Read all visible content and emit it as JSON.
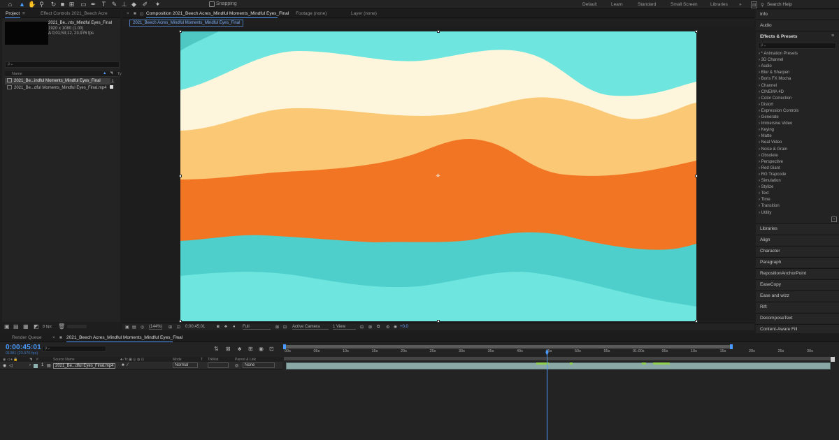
{
  "toolbar": {
    "snapping_label": "Snapping",
    "workspaces": [
      "Default",
      "Learn",
      "Standard",
      "Small Screen",
      "Libraries"
    ],
    "search_help": "Search Help"
  },
  "project_panel": {
    "tabs": [
      "Project",
      "Effect Controls 2021_Beech Acre"
    ],
    "comp_name": "2021_Be...nts_Mindful Eyes_Final",
    "comp_resolution": "1920 x 1080 (1.00)",
    "comp_duration": "Δ 0;01;53;12, 23.976 fps",
    "search_placeholder": "ρ⌄",
    "column_name": "Name",
    "column_type": "Ty",
    "items": [
      {
        "name": "2021_Be...indful Moments_Mindful Eyes_Final",
        "selected": true
      },
      {
        "name": "2021_Be...dful Moments_Mindful Eyes_Final.mp4",
        "selected": false
      }
    ],
    "bpc": "8 bpc"
  },
  "composition_panel": {
    "tabs": [
      {
        "label": "Composition 2021_Beech Acres_Mindful Moments_Mindful Eyes_Final",
        "active": true
      },
      {
        "label": "Footage (none)",
        "active": false
      },
      {
        "label": "Layer (none)",
        "active": false
      }
    ],
    "breadcrumb": "2021_Beech Acres_Mindful Moments_Mindful Eyes_Final",
    "viewer_bar": {
      "zoom": "(144%)",
      "timecode": "0;00;45;01",
      "resolution": "Full",
      "camera": "Active Camera",
      "views": "1 View",
      "exposure": "+0.0"
    }
  },
  "right_panel": {
    "top_panels": [
      "Info",
      "Audio"
    ],
    "effects_header": "Effects & Presets",
    "effects_search": "ρ⌄",
    "effects": [
      "* Animation Presets",
      "3D Channel",
      "Audio",
      "Blur & Sharpen",
      "Boris FX Mocha",
      "Channel",
      "CINEMA 4D",
      "Color Correction",
      "Distort",
      "Expression Controls",
      "Generate",
      "Immersive Video",
      "Keying",
      "Matte",
      "Neat Video",
      "Noise & Grain",
      "Obsolete",
      "Perspective",
      "Red Giant",
      "RG Trapcode",
      "Simulation",
      "Stylize",
      "Text",
      "Time",
      "Transition",
      "Utility"
    ],
    "panels": [
      "Libraries",
      "Align",
      "Character",
      "Paragraph",
      "RepositionAnchorPoint",
      "EaseCopy",
      "Ease and wizz",
      "Rift",
      "DecomposeText",
      "Content-Aware Fill"
    ]
  },
  "timeline": {
    "tabs": [
      "Render Queue",
      "2021_Beech Acres_Mindful Moments_Mindful Eyes_Final"
    ],
    "timecode": "0:00:45:01",
    "fps": "01081 (23.976 fps)",
    "columns": [
      "Source Name",
      "Mode",
      "T",
      "TrkMat",
      "Parent & Link"
    ],
    "layer": {
      "index": "1",
      "name": "2021_Be...dful Eyes_Final.mp4",
      "mode": "Normal",
      "parent": "None"
    },
    "ruler_ticks": [
      "00s",
      "05s",
      "10s",
      "15s",
      "20s",
      "25s",
      "30s",
      "35s",
      "40s",
      "45s",
      "50s",
      "55s",
      "01:00s",
      "05s",
      "10s",
      "15s",
      "20s",
      "25s",
      "30s"
    ],
    "playhead_position_seconds": 45
  },
  "colors": {
    "accent": "#4a9bff",
    "canvas_bands": [
      "#6ee6df",
      "#fdf6dc",
      "#fbc876",
      "#f27524",
      "#4ecfcb",
      "#6ee6df"
    ]
  }
}
